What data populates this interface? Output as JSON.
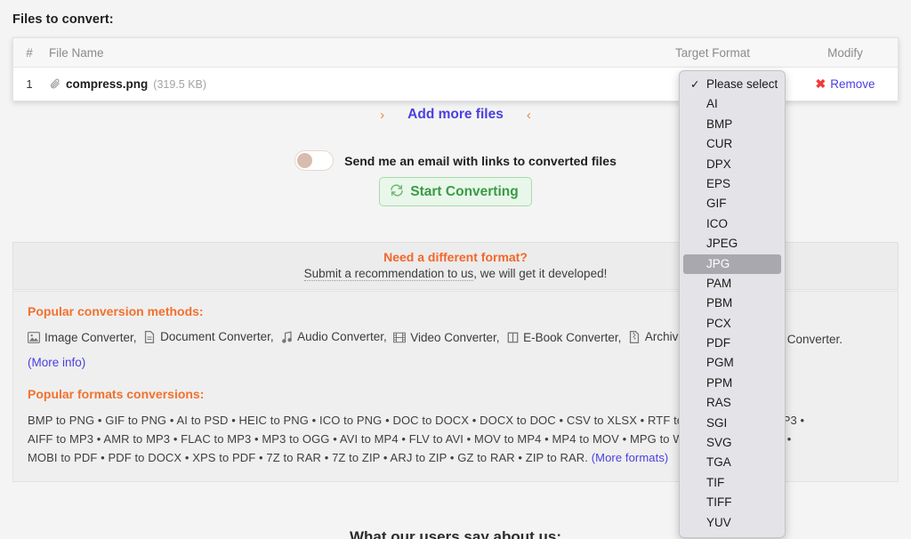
{
  "page": {
    "title": "Files to convert:",
    "bottom_heading": "What our users say about us:"
  },
  "file_table": {
    "headers": {
      "number": "#",
      "file_name": "File Name",
      "target_format": "Target Format",
      "modify": "Modify"
    },
    "rows": [
      {
        "number": "1",
        "attach_icon": "paperclip-icon",
        "file_name": "compress.png",
        "file_size": "(319.5 KB)",
        "remove_label": "Remove",
        "remove_icon": "red-x-icon"
      }
    ]
  },
  "add_more": {
    "arrow_right": "›",
    "arrow_left": "‹",
    "label": "Add more files"
  },
  "email_option": {
    "label": "Send me an email with links to converted files",
    "enabled": false
  },
  "start_button": {
    "label": "Start Converting",
    "icon": "refresh-convert-icon"
  },
  "different_format": {
    "title": "Need a different format?",
    "link_text": "Submit a recommendation to us",
    "rest_text": ", we will get it developed!"
  },
  "popular_methods": {
    "title": "Popular conversion methods:",
    "items": [
      {
        "icon": "image-icon",
        "label": "Image Converter,"
      },
      {
        "icon": "document-icon",
        "label": "Document Converter,"
      },
      {
        "icon": "music-note-icon",
        "label": "Audio Converter,"
      },
      {
        "icon": "film-icon",
        "label": "Video Converter,"
      },
      {
        "icon": "book-icon",
        "label": "E-Book Converter,"
      },
      {
        "icon": "archive-icon",
        "label": "Archive Converter,"
      },
      {
        "icon": "image-icon",
        "label": "Image Converter."
      }
    ],
    "more_info": "(More info)"
  },
  "popular_formats": {
    "title": "Popular formats conversions:",
    "lines": [
      "BMP to PNG • GIF to PNG • AI to PSD • HEIC to PNG • ICO to PNG • DOC to DOCX • DOCX to DOC • CSV to XLSX • RTF to DOCX • WAV to MP3 •",
      "AIFF to MP3 • AMR to MP3 • FLAC to MP3 • MP3 to OGG • AVI to MP4 • FLV to AVI • MOV to MP4 • MP4 to MOV • MPG to WMV • EPUB to PDF •"
    ],
    "last_line_text": "MOBI to PDF • PDF to DOCX • XPS to PDF • 7Z to RAR • 7Z to ZIP • ARJ to ZIP • GZ to RAR • ZIP to RAR. ",
    "more_formats": "(More formats)"
  },
  "format_dropdown": {
    "open": true,
    "selected": "JPG",
    "checked": "Please select",
    "options": [
      "Please select",
      "AI",
      "BMP",
      "CUR",
      "DPX",
      "EPS",
      "GIF",
      "ICO",
      "JPEG",
      "JPG",
      "PAM",
      "PBM",
      "PCX",
      "PDF",
      "PGM",
      "PPM",
      "RAS",
      "SGI",
      "SVG",
      "TGA",
      "TIF",
      "TIFF",
      "YUV"
    ]
  },
  "colors": {
    "accent_orange": "#f2712d",
    "link_blue": "#4a3fe0",
    "green": "#3a9b45",
    "red": "#ef3b3b",
    "highlight_gray": "#a8a8ae"
  }
}
